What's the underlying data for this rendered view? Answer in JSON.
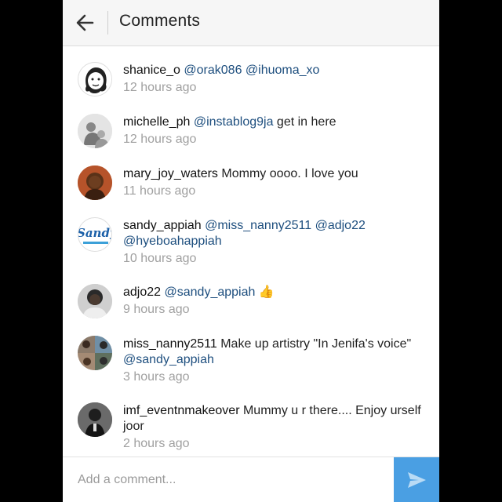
{
  "header": {
    "title": "Comments",
    "back_icon": "arrow-left-icon"
  },
  "comments": [
    {
      "user": "shanice_o",
      "mentions": [
        "@orak086",
        "@ihuoma_xo"
      ],
      "text": "",
      "time": "12 hours ago"
    },
    {
      "user": "michelle_ph",
      "mentions": [
        "@instablog9ja"
      ],
      "text": " get in here",
      "time": "12 hours ago"
    },
    {
      "user": "mary_joy_waters",
      "mentions": [],
      "text": " Mommy oooo. I love you",
      "time": "11 hours ago"
    },
    {
      "user": "sandy_appiah",
      "mentions": [
        "@miss_nanny2511",
        "@adjo22",
        "@hyeboahappiah"
      ],
      "text": "",
      "time": "10 hours ago",
      "avatar_text": "Sandy"
    },
    {
      "user": "adjo22",
      "mentions": [
        "@sandy_appiah"
      ],
      "text": "",
      "emoji": "👍",
      "time": "9 hours ago"
    },
    {
      "user": "miss_nanny2511",
      "text_before": " Make up artistry \"In Jenifa's voice\" ",
      "mentions": [
        "@sandy_appiah"
      ],
      "time": "3 hours ago"
    },
    {
      "user": "imf_eventnmakeover",
      "mentions": [],
      "text": " Mummy u r there.... Enjoy urself joor",
      "time": "2 hours ago"
    }
  ],
  "footer": {
    "placeholder": "Add a comment...",
    "send_icon": "send-icon"
  },
  "colors": {
    "mention": "#1d4e7e",
    "timestamp": "#a0a0a0",
    "send_button": "#4a9fe3",
    "header_bg": "#f6f6f6"
  }
}
